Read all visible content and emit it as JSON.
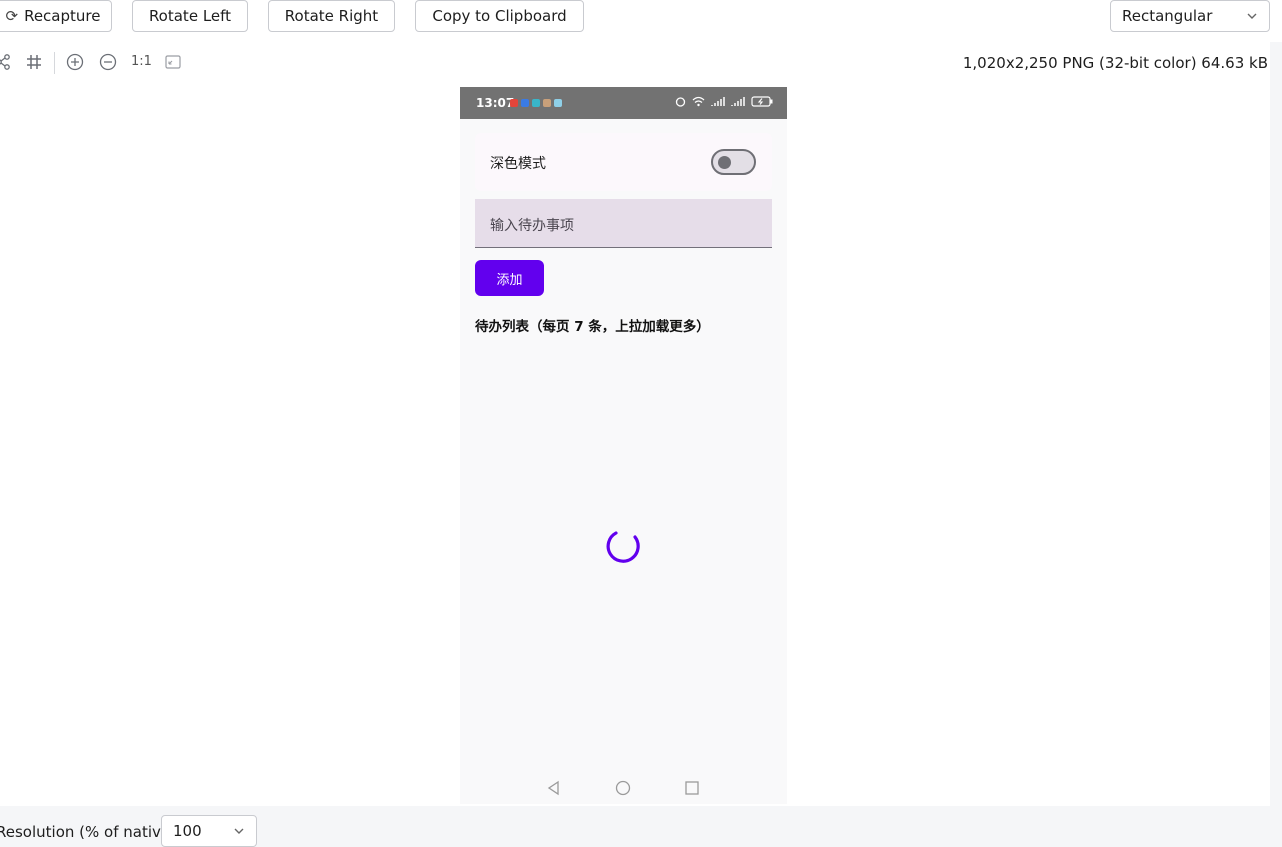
{
  "toolbar": {
    "recapture_label": "Recapture",
    "rotate_left_label": "Rotate Left",
    "rotate_right_label": "Rotate Right",
    "copy_label": "Copy to Clipboard",
    "mode_selected": "Rectangular"
  },
  "viewer": {
    "zoom_reset_label": "1:1",
    "image_info": "1,020x2,250 PNG (32-bit color) 64.63 kB"
  },
  "phone": {
    "status_time": "13:07",
    "dark_mode_label": "深色模式",
    "dark_mode_on": false,
    "input_placeholder": "输入待办事项",
    "add_button_label": "添加",
    "list_title": "待办列表（每页 7 条，上拉加载更多）",
    "accent_color": "#6200ee"
  },
  "bottom": {
    "resolution_label": "Resolution (% of native):",
    "resolution_value": "100"
  },
  "icons": [
    "refresh-icon",
    "share-nodes-icon",
    "crop-grid-icon",
    "zoom-in-icon",
    "zoom-out-icon",
    "fit-window-icon",
    "chevron-down-icon",
    "back-triangle-icon",
    "home-circle-icon",
    "recents-square-icon",
    "loading-spinner-icon"
  ]
}
